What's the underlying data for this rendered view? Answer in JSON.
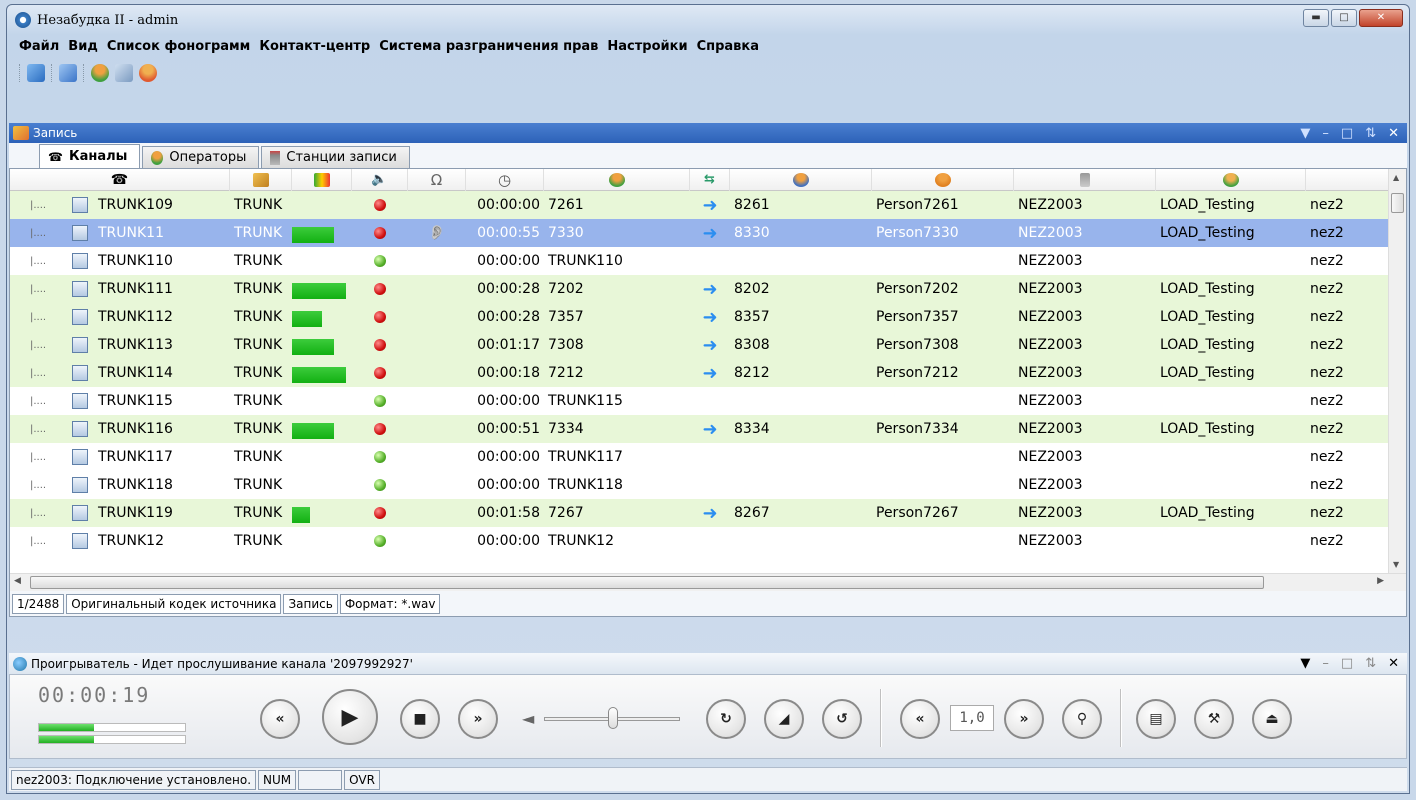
{
  "window": {
    "title": "Незабудка II - admin"
  },
  "menu": [
    "Файл",
    "Вид",
    "Список фонограмм",
    "Контакт-центр",
    "Система разграничения прав",
    "Настройки",
    "Справка"
  ],
  "record_panel": {
    "title": "Запись"
  },
  "tabs": [
    "Каналы",
    "Операторы",
    "Станции записи"
  ],
  "rows": [
    {
      "name": "TRUNK109",
      "type": "TRUNK",
      "state": "active",
      "level": 0,
      "dot": "red",
      "rec": false,
      "time": "00:00:00",
      "caller": "7261",
      "arrow": true,
      "callee": "8261",
      "person": "Person7261",
      "station": "NEZ2003",
      "group": "LOAD_Testing",
      "server": "nez2"
    },
    {
      "name": "TRUNK11",
      "type": "TRUNK",
      "state": "selected",
      "level": 0.78,
      "dot": "red",
      "rec": true,
      "time": "00:00:55",
      "caller": "7330",
      "arrow": true,
      "callee": "8330",
      "person": "Person7330",
      "station": "NEZ2003",
      "group": "LOAD_Testing",
      "server": "nez2"
    },
    {
      "name": "TRUNK110",
      "type": "TRUNK",
      "state": "idle",
      "level": 0,
      "dot": "green",
      "rec": false,
      "time": "00:00:00",
      "caller": "TRUNK110",
      "arrow": false,
      "callee": "",
      "person": "",
      "station": "NEZ2003",
      "group": "",
      "server": "nez2"
    },
    {
      "name": "TRUNK111",
      "type": "TRUNK",
      "state": "active",
      "level": 1,
      "dot": "red",
      "rec": false,
      "time": "00:00:28",
      "caller": "7202",
      "arrow": true,
      "callee": "8202",
      "person": "Person7202",
      "station": "NEZ2003",
      "group": "LOAD_Testing",
      "server": "nez2"
    },
    {
      "name": "TRUNK112",
      "type": "TRUNK",
      "state": "active",
      "level": 0.56,
      "dot": "red",
      "rec": false,
      "time": "00:00:28",
      "caller": "7357",
      "arrow": true,
      "callee": "8357",
      "person": "Person7357",
      "station": "NEZ2003",
      "group": "LOAD_Testing",
      "server": "nez2"
    },
    {
      "name": "TRUNK113",
      "type": "TRUNK",
      "state": "active",
      "level": 0.78,
      "dot": "red",
      "rec": false,
      "time": "00:01:17",
      "caller": "7308",
      "arrow": true,
      "callee": "8308",
      "person": "Person7308",
      "station": "NEZ2003",
      "group": "LOAD_Testing",
      "server": "nez2"
    },
    {
      "name": "TRUNK114",
      "type": "TRUNK",
      "state": "active",
      "level": 1,
      "dot": "red",
      "rec": false,
      "time": "00:00:18",
      "caller": "7212",
      "arrow": true,
      "callee": "8212",
      "person": "Person7212",
      "station": "NEZ2003",
      "group": "LOAD_Testing",
      "server": "nez2"
    },
    {
      "name": "TRUNK115",
      "type": "TRUNK",
      "state": "idle",
      "level": 0,
      "dot": "green",
      "rec": false,
      "time": "00:00:00",
      "caller": "TRUNK115",
      "arrow": false,
      "callee": "",
      "person": "",
      "station": "NEZ2003",
      "group": "",
      "server": "nez2"
    },
    {
      "name": "TRUNK116",
      "type": "TRUNK",
      "state": "active",
      "level": 0.78,
      "dot": "red",
      "rec": false,
      "time": "00:00:51",
      "caller": "7334",
      "arrow": true,
      "callee": "8334",
      "person": "Person7334",
      "station": "NEZ2003",
      "group": "LOAD_Testing",
      "server": "nez2"
    },
    {
      "name": "TRUNK117",
      "type": "TRUNK",
      "state": "idle",
      "level": 0,
      "dot": "green",
      "rec": false,
      "time": "00:00:00",
      "caller": "TRUNK117",
      "arrow": false,
      "callee": "",
      "person": "",
      "station": "NEZ2003",
      "group": "",
      "server": "nez2"
    },
    {
      "name": "TRUNK118",
      "type": "TRUNK",
      "state": "idle",
      "level": 0,
      "dot": "green",
      "rec": false,
      "time": "00:00:00",
      "caller": "TRUNK118",
      "arrow": false,
      "callee": "",
      "person": "",
      "station": "NEZ2003",
      "group": "",
      "server": "nez2"
    },
    {
      "name": "TRUNK119",
      "type": "TRUNK",
      "state": "active",
      "level": 0.33,
      "dot": "red",
      "rec": false,
      "time": "00:01:58",
      "caller": "7267",
      "arrow": true,
      "callee": "8267",
      "person": "Person7267",
      "station": "NEZ2003",
      "group": "LOAD_Testing",
      "server": "nez2"
    },
    {
      "name": "TRUNK12",
      "type": "TRUNK",
      "state": "idle",
      "level": 0,
      "dot": "green",
      "rec": false,
      "time": "00:00:00",
      "caller": "TRUNK12",
      "arrow": false,
      "callee": "",
      "person": "",
      "station": "NEZ2003",
      "group": "",
      "server": "nez2"
    }
  ],
  "status": {
    "count": "1/2488",
    "codec": "Оригинальный кодек источника",
    "mode": "Запись",
    "format": "Формат: *.wav"
  },
  "player": {
    "title": "Проигрыватель - Идет прослушивание канала '2097992927'",
    "time": "00:00:19",
    "speed": "1,0",
    "meter_levels": [
      0.37,
      0.37
    ]
  },
  "bottom_status": {
    "connection": "nez2003: Подключение установлено.",
    "num": "NUM",
    "blank": "",
    "ovr": "OVR"
  },
  "colors": {
    "active_row": "#e8f7d8",
    "selected_row": "#98b4ec",
    "panel_header": "#2d62b8"
  }
}
